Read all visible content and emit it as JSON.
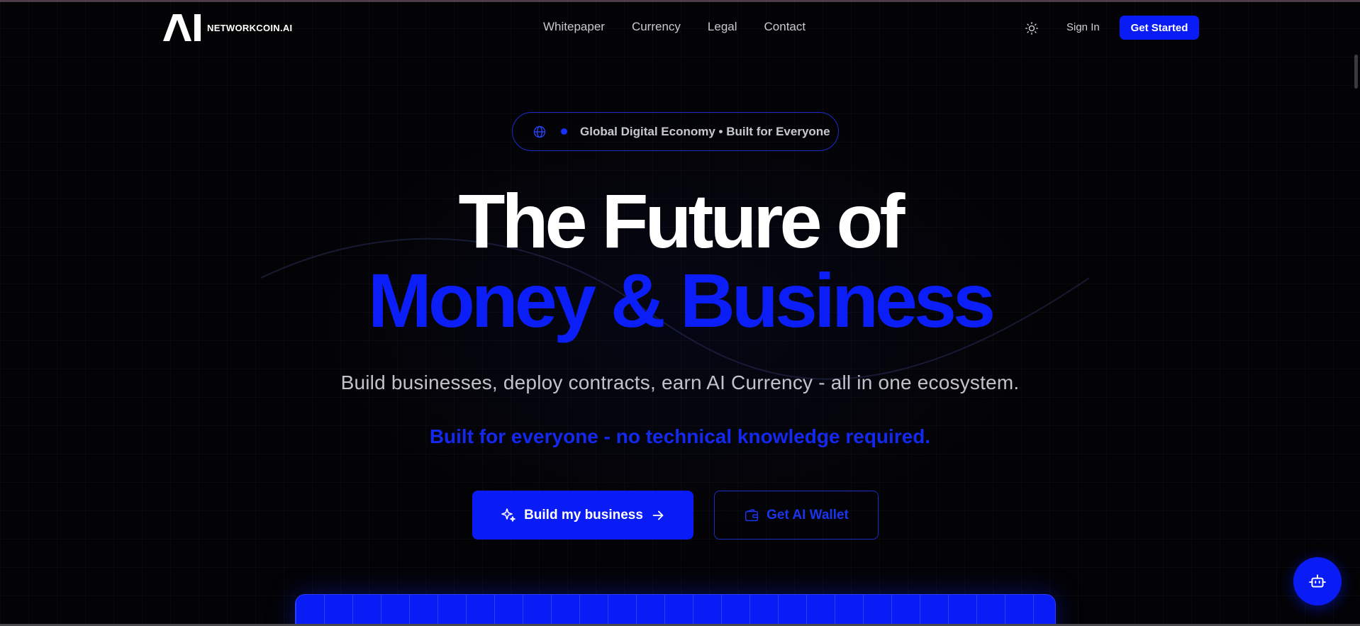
{
  "brand": {
    "name": "NETWORKCOIN.AI",
    "mark": "AI"
  },
  "nav": {
    "links": [
      "Whitepaper",
      "Currency",
      "Legal",
      "Contact"
    ],
    "sign_in": "Sign In",
    "get_started": "Get Started"
  },
  "hero": {
    "badge": "Global Digital Economy • Built for Everyone",
    "title_line1": "The Future of",
    "title_line2": "Money & Business",
    "subtitle": "Build businesses, deploy contracts, earn AI Currency - all in one ecosystem.",
    "tagline": "Built for everyone - no technical knowledge required.",
    "primary_cta": "Build my business",
    "secondary_cta": "Get AI Wallet"
  },
  "colors": {
    "accent": "#0a1cf5",
    "background": "#030305",
    "text_muted": "#c2c2cb"
  },
  "icons": {
    "theme": "sun-icon",
    "badge": "globe-icon",
    "primary_cta_lead": "sparkles-icon",
    "primary_cta_trail": "arrow-right-icon",
    "secondary_cta": "wallet-icon",
    "chat": "robot-icon"
  }
}
